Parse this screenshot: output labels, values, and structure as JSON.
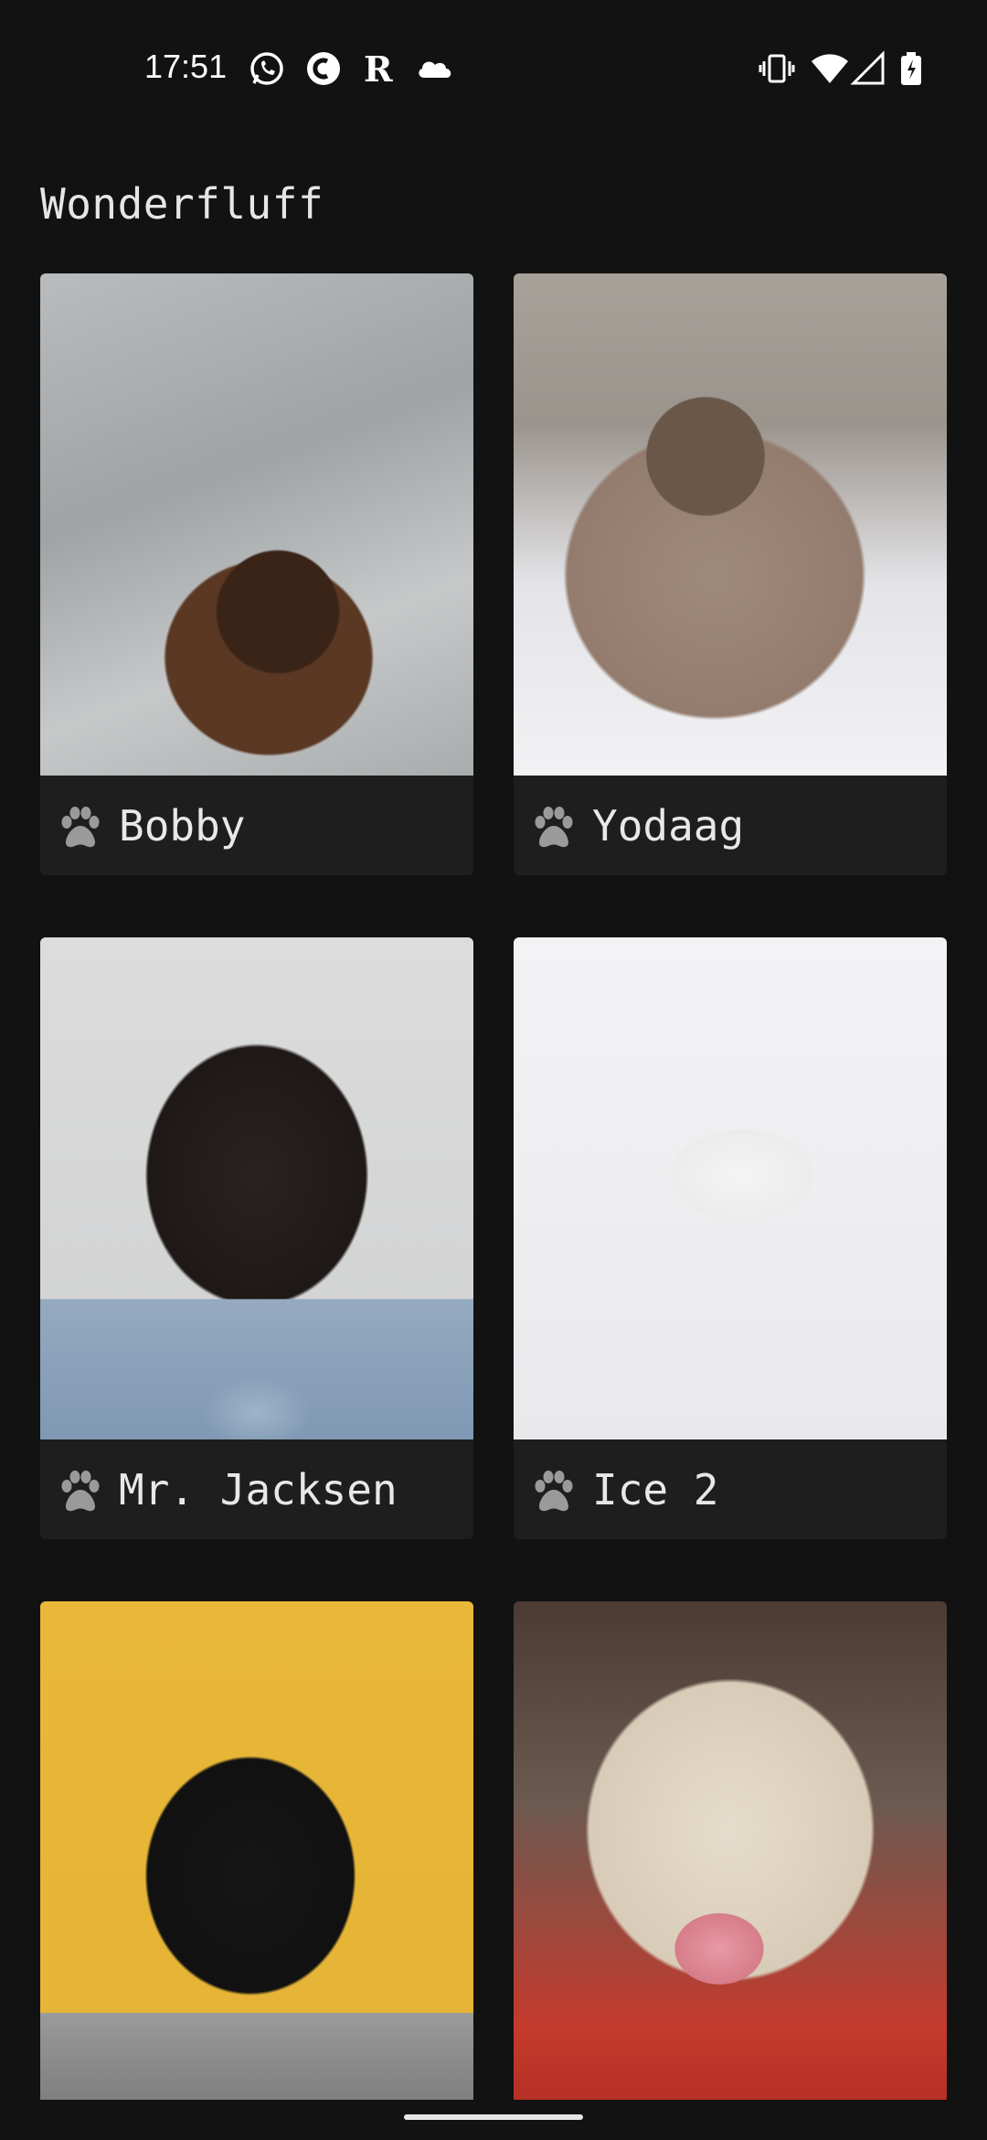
{
  "status_bar": {
    "time": "17:51",
    "left_icons": [
      "whatsapp-icon",
      "app-c-icon",
      "r-letter-icon",
      "cloud-icon"
    ],
    "right_icons": [
      "vibrate-icon",
      "wifi-icon",
      "cell-signal-icon",
      "battery-charging-icon"
    ]
  },
  "app": {
    "title": "Wonderfluff"
  },
  "pets": [
    {
      "name": "Bobby",
      "icon": "paw-icon"
    },
    {
      "name": "Yodaag",
      "icon": "paw-icon"
    },
    {
      "name": "Mr. Jacksen",
      "icon": "paw-icon"
    },
    {
      "name": "Ice 2",
      "icon": "paw-icon"
    },
    {
      "name": "",
      "icon": ""
    },
    {
      "name": "",
      "icon": ""
    }
  ],
  "colors": {
    "background": "#121212",
    "card_footer": "#1e1e1e",
    "text": "#e8e8e8"
  }
}
